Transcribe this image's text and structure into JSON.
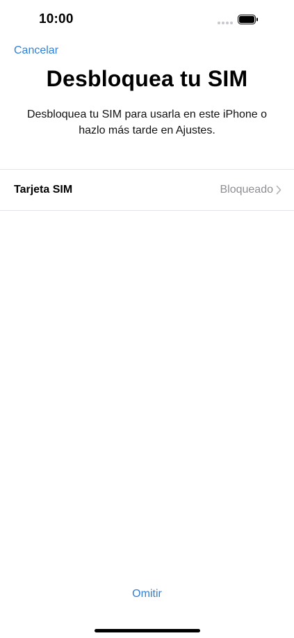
{
  "status_bar": {
    "time": "10:00",
    "signal_icon": "signal-dots-icon",
    "battery_icon": "battery-full-icon"
  },
  "nav": {
    "cancel_label": "Cancelar"
  },
  "header": {
    "title": "Desbloquea tu SIM",
    "subtitle": "Desbloquea tu SIM para usarla en este iPhone o hazlo más tarde en Ajustes."
  },
  "sim_row": {
    "label": "Tarjeta SIM",
    "value": "Bloqueado",
    "chevron_icon": "chevron-right-icon"
  },
  "footer": {
    "skip_label": "Omitir"
  },
  "colors": {
    "accent": "#2f7fd6",
    "secondary_text": "#8e8e93",
    "divider": "#e5e5ea"
  }
}
